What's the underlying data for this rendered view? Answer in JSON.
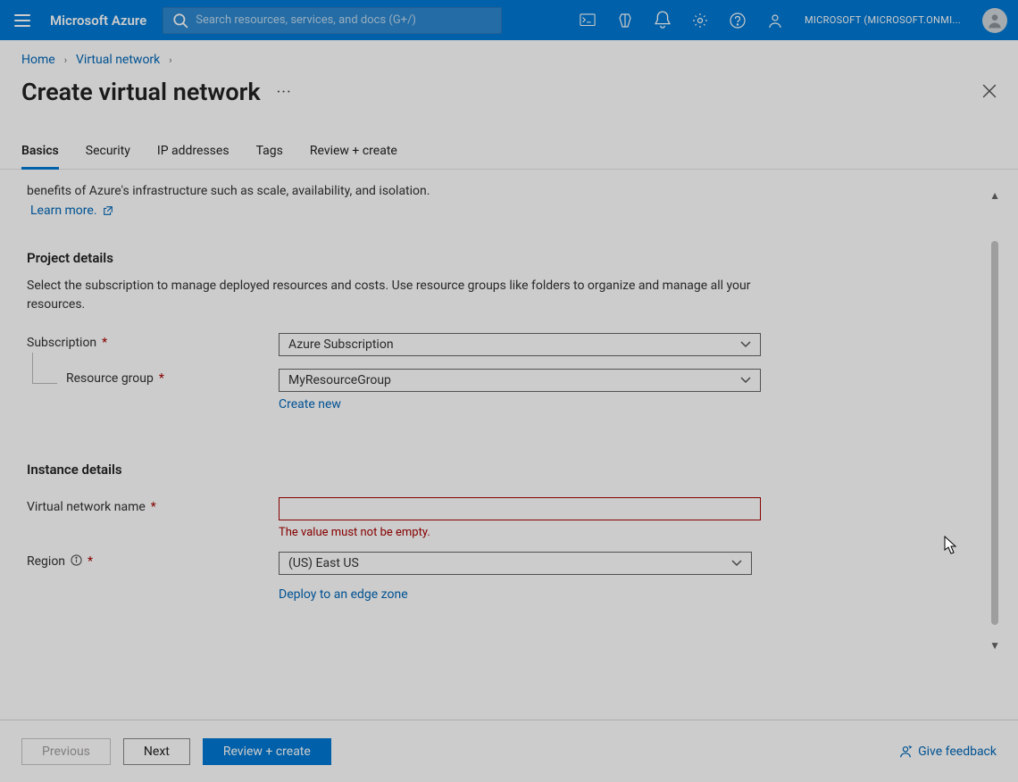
{
  "topbar": {
    "brand": "Microsoft Azure",
    "search_placeholder": "Search resources, services, and docs (G+/)",
    "account": "MICROSOFT (MICROSOFT.ONMI..."
  },
  "breadcrumbs": {
    "home": "Home",
    "vnet": "Virtual network"
  },
  "page_title": "Create virtual network",
  "tabs": {
    "basics": "Basics",
    "security": "Security",
    "ip": "IP addresses",
    "tags": "Tags",
    "review": "Review + create"
  },
  "intro": {
    "fragment": "benefits of Azure's infrastructure such as scale, availability, and isolation.",
    "learn_more": "Learn more."
  },
  "project": {
    "heading": "Project details",
    "text": "Select the subscription to manage deployed resources and costs. Use resource groups like folders to organize and manage all your resources.",
    "subscription_label": "Subscription",
    "subscription_value": "Azure Subscription",
    "rg_label": "Resource group",
    "rg_value": "MyResourceGroup",
    "create_new": "Create new"
  },
  "instance": {
    "heading": "Instance details",
    "name_label": "Virtual network name",
    "name_value": "",
    "name_error": "The value must not be empty.",
    "region_label": "Region",
    "region_value": "(US) East US",
    "edge_link": "Deploy to an edge zone"
  },
  "footer": {
    "previous": "Previous",
    "next": "Next",
    "review": "Review + create",
    "feedback": "Give feedback"
  }
}
